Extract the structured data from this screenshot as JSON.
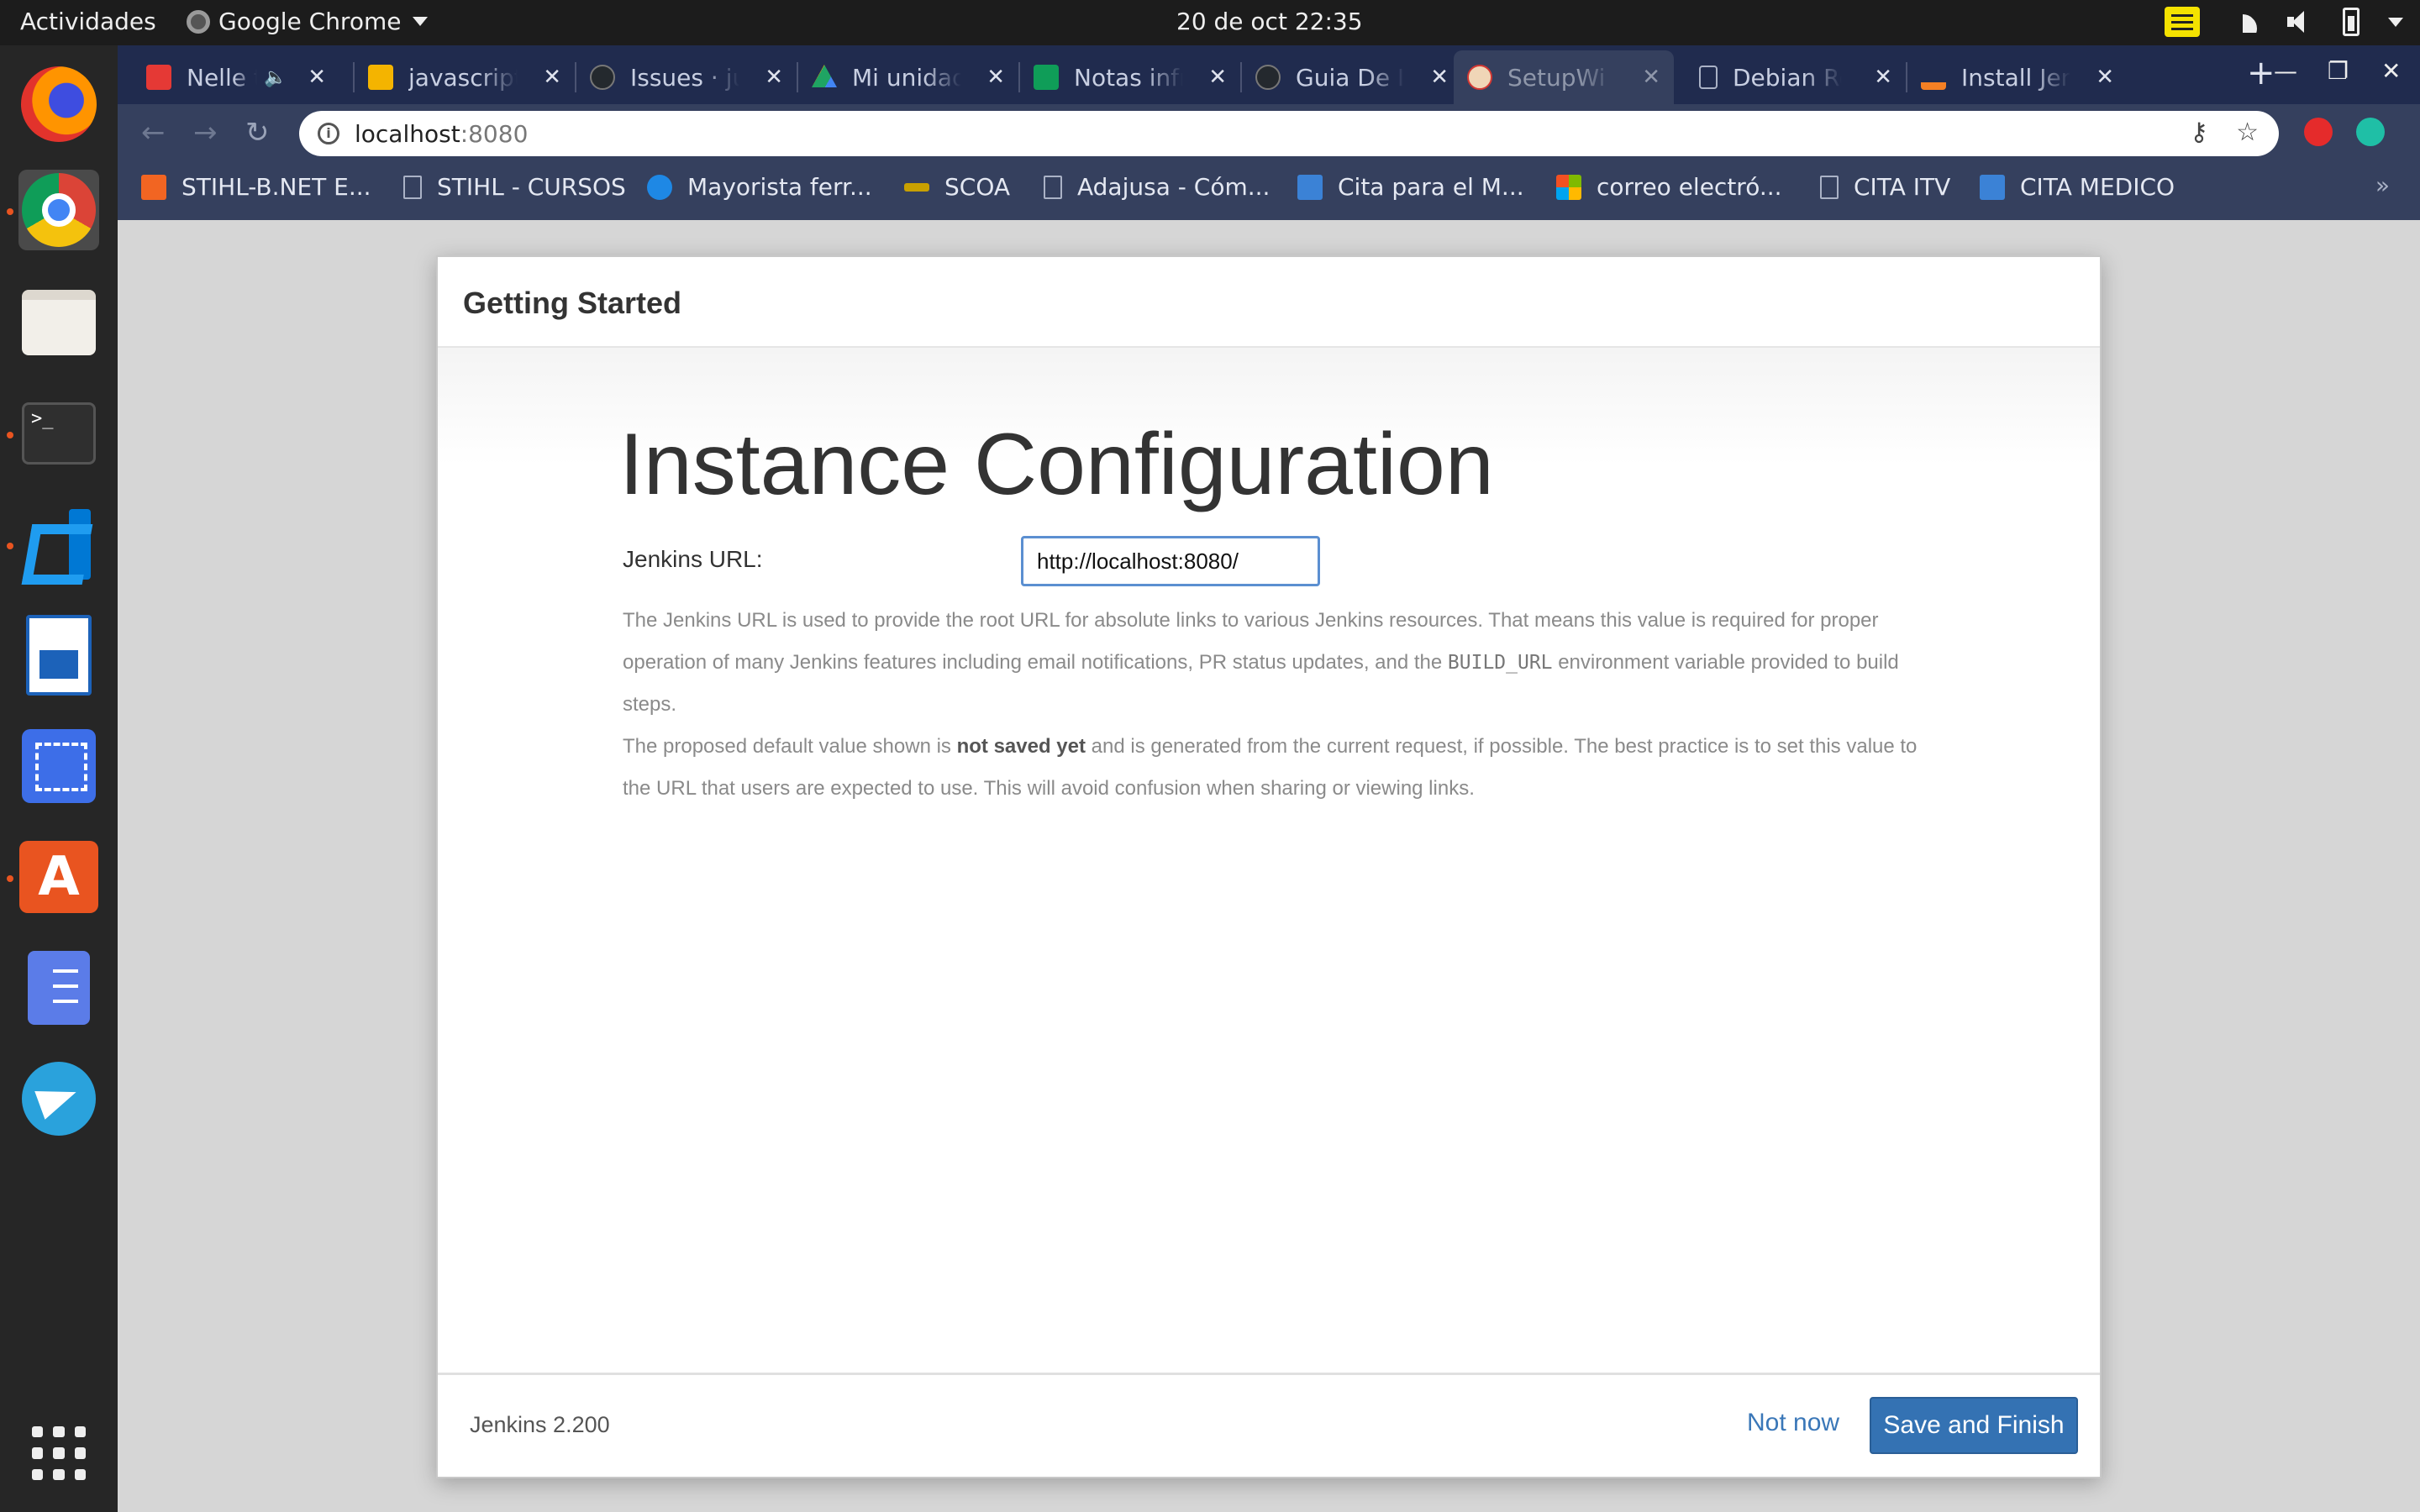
{
  "system": {
    "activities": "Actividades",
    "app_name": "Google Chrome",
    "clock": "20 de oct  22:35"
  },
  "tabs": [
    {
      "label": "Nelle t",
      "favicon_color": "#e53935"
    },
    {
      "label": "javascript",
      "favicon_color": "#f4b400"
    },
    {
      "label": "Issues · ju",
      "favicon_color": "#24292e"
    },
    {
      "label": "Mi unidad",
      "favicon_color": "#1fa463"
    },
    {
      "label": "Notas infr",
      "favicon_color": "#0f9d58"
    },
    {
      "label": "Guia De In",
      "favicon_color": "#24292e"
    },
    {
      "label": "SetupWi",
      "favicon_color": "#d33833"
    },
    {
      "label": "Debian Re",
      "favicon_color": "#aab2c6"
    },
    {
      "label": "Install Jen",
      "favicon_color": "#f48024"
    }
  ],
  "address": {
    "host": "localhost",
    "port": ":8080"
  },
  "bookmarks": [
    {
      "label": "STIHL-B.NET E...",
      "icon": "stihl-icon",
      "color": "#f26522"
    },
    {
      "label": "STIHL - CURSOS",
      "icon": "page-icon",
      "color": ""
    },
    {
      "label": "Mayorista ferr...",
      "icon": "mayorista-icon",
      "color": "#1e88e5"
    },
    {
      "label": "SCOA",
      "icon": "scoa-icon",
      "color": "#c8a000"
    },
    {
      "label": "Adajusa - Cóm...",
      "icon": "page-icon",
      "color": ""
    },
    {
      "label": "Cita para el M...",
      "icon": "wifi-bookmark-icon",
      "color": "#3b82d6"
    },
    {
      "label": "correo electró...",
      "icon": "microsoft-icon",
      "color": "#f25022"
    },
    {
      "label": "CITA ITV",
      "icon": "page-icon",
      "color": ""
    },
    {
      "label": "CITA MEDICO",
      "icon": "wifi-bookmark-icon",
      "color": "#3b82d6"
    }
  ],
  "dialog": {
    "header": "Getting Started",
    "title": "Instance Configuration",
    "url_label": "Jenkins URL:",
    "url_value": "http://localhost:8080/",
    "help1_a": "The Jenkins URL is used to provide the root URL for absolute links to various Jenkins resources. That means this value is required for proper operation of many Jenkins features including email notifications, PR status updates, and the ",
    "help1_code": "BUILD_URL",
    "help1_b": " environment variable provided to build steps.",
    "help2_a": "The proposed default value shown is ",
    "help2_bold": "not saved yet",
    "help2_b": " and is generated from the current request, if possible. The best practice is to set this value to the URL that users are expected to use. This will avoid confusion when sharing or viewing links.",
    "version": "Jenkins 2.200",
    "not_now": "Not now",
    "save_finish": "Save and Finish"
  }
}
